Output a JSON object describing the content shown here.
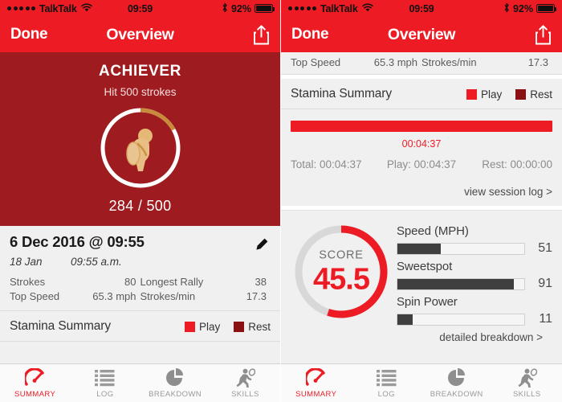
{
  "status_bar": {
    "signal_dots": 5,
    "carrier": "TalkTalk",
    "wifi_icon": "wifi-icon",
    "time": "09:59",
    "bluetooth_icon": "bluetooth-icon",
    "battery_percent": "92%",
    "battery_level": 92
  },
  "nav": {
    "done_label": "Done",
    "title": "Overview",
    "share_icon": "share-icon"
  },
  "achievement": {
    "title": "ACHIEVER",
    "subtitle": "Hit 500 strokes",
    "progress_text": "284 / 500",
    "current": 284,
    "goal": 500,
    "ring_icon": "tennis-player-badge-icon",
    "arc_percent": 17,
    "arc_color": "#C98A3C",
    "ring_color": "#FFFFFF",
    "background": "#9E1B1F"
  },
  "session": {
    "date_title": "6 Dec 2016 @ 09:55",
    "sub_date": "18 Jan",
    "sub_time": "09:55 a.m.",
    "edit_icon": "pencil-edit-icon",
    "stats_left": [
      {
        "label": "Strokes",
        "value": "80"
      },
      {
        "label": "Top Speed",
        "value": "65.3 mph"
      }
    ],
    "stats_right": [
      {
        "label": "Longest Rally",
        "value": "38"
      },
      {
        "label": "Strokes/min",
        "value": "17.3"
      }
    ]
  },
  "stamina": {
    "title": "Stamina Summary",
    "legend": [
      {
        "label": "Play",
        "color": "#ED1C24"
      },
      {
        "label": "Rest",
        "color": "#8B1014"
      }
    ],
    "bar_label": "00:04:37",
    "play_percent": 100,
    "totals": {
      "total": "Total: 00:04:37",
      "play": "Play: 00:04:37",
      "rest": "Rest: 00:00:00"
    },
    "session_log_link": "view session log >"
  },
  "score": {
    "label": "SCORE",
    "value": "45.5",
    "arc_percent": 55,
    "arc_color": "#ED1C24",
    "track_color": "#D8D8D8",
    "skills": [
      {
        "name": "Speed (MPH)",
        "value": "51",
        "percent": 34
      },
      {
        "name": "Sweetspot",
        "value": "91",
        "percent": 92
      },
      {
        "name": "Spin Power",
        "value": "11",
        "percent": 12
      }
    ],
    "breakdown_link": "detailed breakdown >"
  },
  "tabbar": {
    "tabs": [
      {
        "label": "SUMMARY",
        "icon": "speedometer-icon",
        "active": true
      },
      {
        "label": "LOG",
        "icon": "list-icon",
        "active": false
      },
      {
        "label": "BREAKDOWN",
        "icon": "pie-chart-icon",
        "active": false
      },
      {
        "label": "SKILLS",
        "icon": "tennis-player-icon",
        "active": false
      }
    ]
  }
}
